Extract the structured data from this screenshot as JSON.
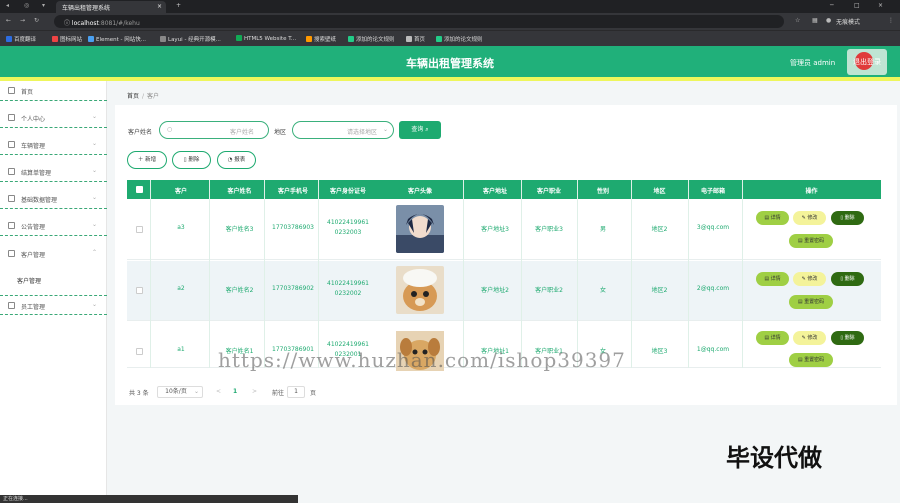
{
  "browser": {
    "tab_title": "车辆出租管理系统",
    "url_host": "localhost",
    "url_rest": ":8081/#/kehu",
    "profile": "无痕模式",
    "bookmarks": [
      "百度翻译",
      "图标网站",
      "Element - 网站快...",
      "Layui - 经典开源模...",
      "HTML5 Website T...",
      "搜索壁纸",
      "添加的论文规则",
      "首页",
      "添加的论文规则"
    ]
  },
  "header": {
    "title": "车辆出租管理系统",
    "user": "管理员 admin",
    "logout": "退出登录"
  },
  "sidebar": {
    "items": [
      {
        "label": "首页",
        "icon": "home-icon"
      },
      {
        "label": "个人中心",
        "icon": "user-icon"
      },
      {
        "label": "车辆管理",
        "icon": "car-icon"
      },
      {
        "label": "结算单管理",
        "icon": "receipt-icon"
      },
      {
        "label": "基础数据管理",
        "icon": "database-icon"
      },
      {
        "label": "公告管理",
        "icon": "notice-icon"
      },
      {
        "label": "客户管理",
        "icon": "customer-icon"
      },
      {
        "label": "员工管理",
        "icon": "staff-icon"
      }
    ],
    "sub_item": "客户管理"
  },
  "breadcrumb": {
    "home": "首页",
    "sep": "/",
    "current": "客户"
  },
  "search": {
    "name_label": "客户姓名",
    "name_placeholder": "客户姓名",
    "area_label": "地区",
    "area_placeholder": "请选择地区",
    "query_button": "查询"
  },
  "actions": {
    "add": "新增",
    "delete": "删除",
    "report": "报表"
  },
  "table": {
    "columns": [
      "客户",
      "客户姓名",
      "客户手机号",
      "客户身份证号",
      "客户头像",
      "客户地址",
      "客户职业",
      "性别",
      "地区",
      "电子邮箱",
      "操作"
    ],
    "rows": [
      {
        "code": "a3",
        "name": "客户姓名3",
        "phone": "17703786903",
        "id1": "41022419961",
        "id2": "0232003",
        "address": "客户地址3",
        "job": "客户职业3",
        "gender": "男",
        "area": "地区2",
        "email": "3@qq.com"
      },
      {
        "code": "a2",
        "name": "客户姓名2",
        "phone": "17703786902",
        "id1": "41022419961",
        "id2": "0232002",
        "address": "客户地址2",
        "job": "客户职业2",
        "gender": "女",
        "area": "地区2",
        "email": "2@qq.com"
      },
      {
        "code": "a1",
        "name": "客户姓名1",
        "phone": "17703786901",
        "id1": "41022419961",
        "id2": "0232001",
        "address": "客户地址1",
        "job": "客户职业1",
        "gender": "女",
        "area": "地区3",
        "email": "1@qq.com"
      }
    ],
    "row_buttons": {
      "detail": "详情",
      "edit": "修改",
      "delete": "删除",
      "reset": "重置密码"
    }
  },
  "pagination": {
    "total": "共 3 条",
    "page_size": "10条/页",
    "prev": "<",
    "page": "1",
    "next": ">",
    "goto": "前往",
    "goto_value": "1",
    "page_unit": "页"
  },
  "overlay": {
    "watermark": "https://www.huzhan.com/ishop39397",
    "stamp": "毕设代做"
  },
  "status_bar": "正在连接..."
}
